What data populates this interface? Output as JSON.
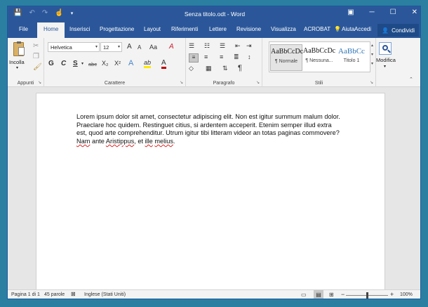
{
  "window": {
    "title": "Senza titolo.odt - Word"
  },
  "qat": {
    "save_icon": "💾",
    "undo_icon": "↶",
    "redo_icon": "↷",
    "touch_icon": "☝",
    "more_icon": "▾"
  },
  "window_controls": {
    "ribbon_options": "▣",
    "minimize": "─",
    "maximize": "☐",
    "close": "✕"
  },
  "tabs": [
    {
      "label": "File"
    },
    {
      "label": "Home"
    },
    {
      "label": "Inserisci"
    },
    {
      "label": "Progettazione"
    },
    {
      "label": "Layout"
    },
    {
      "label": "Riferimenti"
    },
    {
      "label": "Lettere"
    },
    {
      "label": "Revisione"
    },
    {
      "label": "Visualizza"
    },
    {
      "label": "ACROBAT"
    }
  ],
  "tell_me": {
    "label": "Aiuta",
    "icon": "💡"
  },
  "account": {
    "signin": "Accedi",
    "share": "Condividi",
    "share_icon": "👤"
  },
  "ribbon": {
    "clipboard": {
      "label": "Appunti",
      "paste": "Incolla",
      "paste_caret": "▾"
    },
    "font": {
      "label": "Carattere",
      "name": "Helvetica",
      "size": "12",
      "grow": "A",
      "shrink": "A",
      "case": "Aa",
      "clear": "A",
      "bold": "G",
      "italic": "C",
      "underline": "S",
      "strike": "abc",
      "sub": "X₂",
      "sup": "X²",
      "effects": "A",
      "highlight": "ab",
      "color": "A"
    },
    "paragraph": {
      "label": "Paragrafo",
      "pilcrow": "¶"
    },
    "styles": {
      "label": "Stili",
      "items": [
        {
          "preview": "AaBbCcDc",
          "name": "¶ Normale"
        },
        {
          "preview": "AaBbCcDc",
          "name": "¶ Nessuna..."
        },
        {
          "preview": "AaBbCc",
          "name": "Titolo 1"
        }
      ]
    },
    "editing": {
      "label": "Modifica",
      "caret": "▾"
    }
  },
  "document": {
    "text_a": "Lorem ipsum dolor sit amet, consectetur adipiscing elit. Non est igitur summum malum dolor. Praeclare hoc quidem. Restinguet citius, si ardentem acceperit. Etenim semper illud extra est, quod arte comprehenditur. Utrum igitur tibi litteram videor an totas paginas commovere? ",
    "w1": "Nam",
    "s1": " ante ",
    "w2": "Aristippus",
    "s2": ", et ",
    "w3": "ille",
    "s3": " ",
    "w4": "melius",
    "end": "."
  },
  "status": {
    "page": "Pagina 1 di 1",
    "words": "45 parole",
    "language": "Inglese (Stati Uniti)",
    "zoom_minus": "−",
    "zoom_plus": "+",
    "zoom": "100%",
    "zoom_fraction": 0.5
  },
  "colors": {
    "brand": "#2b579a",
    "highlight": "#ffe900",
    "font_color": "#c00000"
  }
}
